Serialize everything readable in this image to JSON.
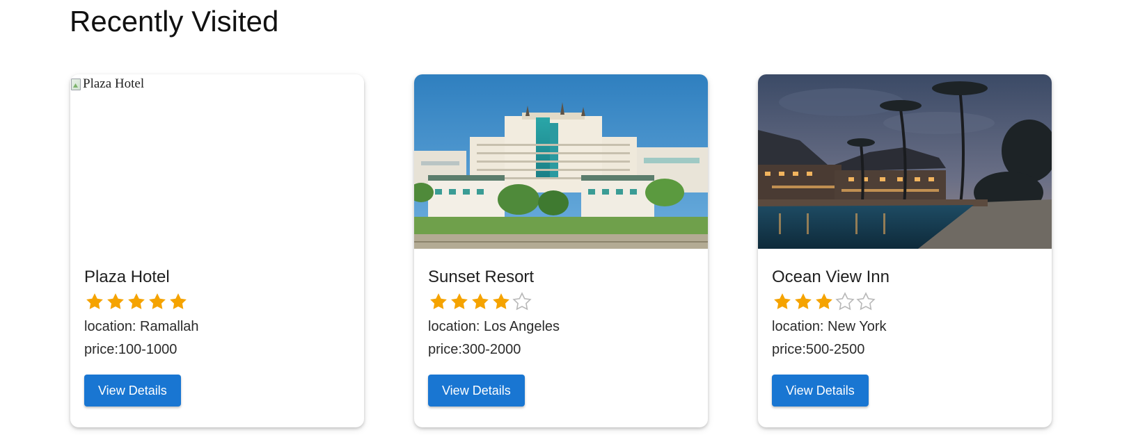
{
  "section": {
    "title": "Recently Visited"
  },
  "colors": {
    "star_filled": "#f5a300",
    "star_empty": "#b8b8b8",
    "button_bg": "#1976d2"
  },
  "hotels": [
    {
      "name": "Plaza Hotel",
      "image_alt": "Plaza Hotel",
      "image_broken": true,
      "rating": 5,
      "rating_max": 5,
      "location": "location: Ramallah",
      "price": "price:100-1000",
      "button_label": "View Details"
    },
    {
      "name": "Sunset Resort",
      "image_alt": "Sunset Resort",
      "image_broken": false,
      "rating": 4,
      "rating_max": 5,
      "location": "location: Los Angeles",
      "price": "price:300-2000",
      "button_label": "View Details"
    },
    {
      "name": "Ocean View Inn",
      "image_alt": "Ocean View Inn",
      "image_broken": false,
      "rating": 3,
      "rating_max": 5,
      "location": "location: New York",
      "price": "price:500-2500",
      "button_label": "View Details"
    }
  ]
}
